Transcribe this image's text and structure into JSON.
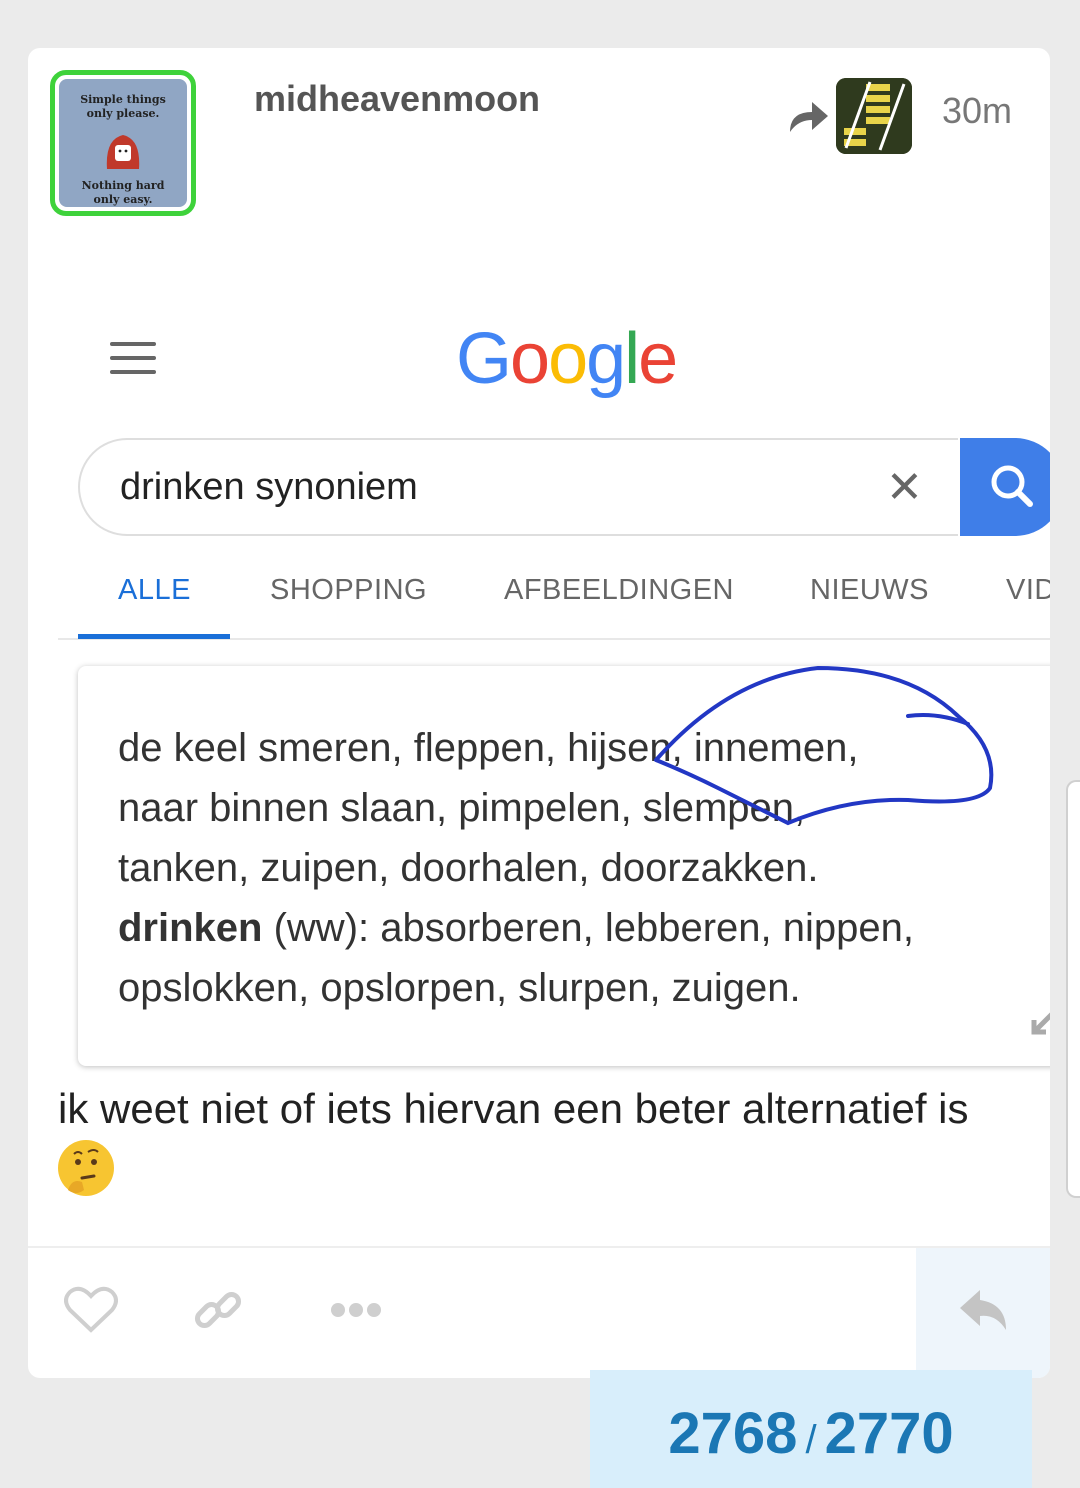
{
  "post": {
    "username": "midheavenmoon",
    "time": "30m",
    "avatar": {
      "top_text_1": "Simple things",
      "top_text_2": "only please.",
      "bottom_text_1": "Nothing hard",
      "bottom_text_2": "only easy."
    },
    "caption": "ik weet niet of iets hiervan een beter alternatief is",
    "emoji_icon": "thinking-face-icon"
  },
  "google": {
    "logo": [
      "G",
      "o",
      "o",
      "g",
      "l",
      "e"
    ],
    "logo_colors": [
      "#4285f4",
      "#ea4335",
      "#fbbc05",
      "#4285f4",
      "#34a853",
      "#ea4335"
    ],
    "query": "drinken synoniem",
    "tabs": [
      "ALLE",
      "SHOPPING",
      "AFBEELDINGEN",
      "NIEUWS",
      "VIDE"
    ],
    "result": {
      "line1": "de keel smeren, fleppen, hijsen, innemen,",
      "line2": "naar binnen slaan, pimpelen, slempen,",
      "line3": "tanken, zuipen, doorhalen, doorzakken.",
      "bold_word": "drinken",
      "line4_rest": " (ww): absorberen, lebberen, nippen,",
      "line5": "opslokken, opslorpen, slurpen, zuigen."
    }
  },
  "counter": {
    "current": "2768",
    "separator": "/",
    "total": "2770"
  },
  "colors": {
    "accent_blue": "#1a6fd8",
    "search_button": "#3f7ee8",
    "avatar_border": "#3ed23b",
    "counter_bg": "#d8eefb",
    "counter_text": "#1b77b4"
  }
}
